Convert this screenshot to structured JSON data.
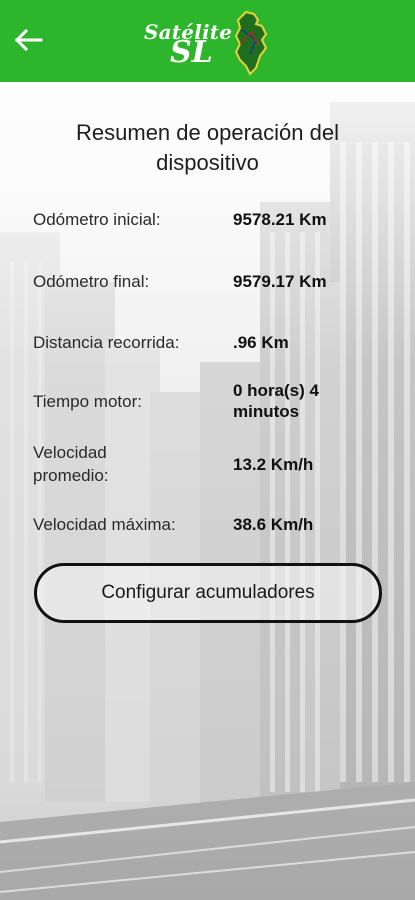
{
  "header": {
    "back_icon": "arrow-left-icon",
    "logo_text_top": "Satélite",
    "logo_text_bottom": "SL",
    "background_color": "#2db52b"
  },
  "summary": {
    "title": "Resumen de operación del dispositivo",
    "rows": [
      {
        "label": "Odómetro inicial:",
        "value": "9578.21 Km"
      },
      {
        "label": "Odómetro final:",
        "value": "9579.17 Km"
      },
      {
        "label": "Distancia recorrida:",
        "value": ".96 Km"
      },
      {
        "label": "Tiempo motor:",
        "value": "0 hora(s) 4 minutos"
      },
      {
        "label": "Velocidad promedio:",
        "value": "13.2 Km/h"
      },
      {
        "label": "Velocidad máxima:",
        "value": "38.6 Km/h"
      }
    ]
  },
  "actions": {
    "configure_label": "Configurar acumuladores"
  }
}
